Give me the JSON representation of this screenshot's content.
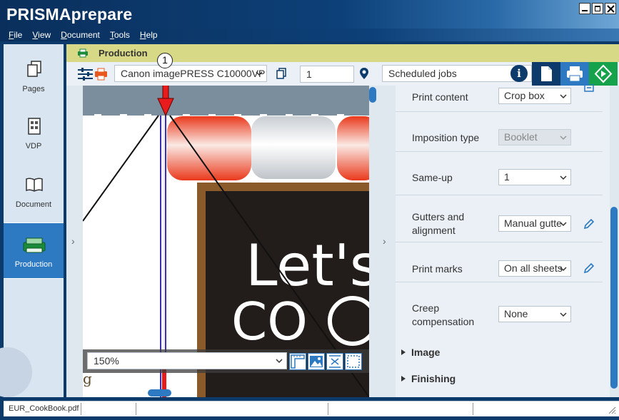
{
  "app": {
    "title": "PRISMAprepare",
    "menu": [
      "File",
      "View",
      "Document",
      "Tools",
      "Help"
    ]
  },
  "nav": {
    "items": [
      {
        "label": "Pages",
        "icon": "pages-icon"
      },
      {
        "label": "VDP",
        "icon": "vdp-icon"
      },
      {
        "label": "Document",
        "icon": "document-book-icon"
      },
      {
        "label": "Production",
        "icon": "production-icon",
        "active": true
      }
    ]
  },
  "production": {
    "title": "Production"
  },
  "toolbar": {
    "printer": "Canon imagePRESS C10000VP",
    "copies": "1",
    "destination": "Scheduled jobs"
  },
  "preview": {
    "zoom": "150%",
    "callout": "1",
    "poster_text_line1": "Let's",
    "poster_text_line2": "CO"
  },
  "panel": {
    "rows": [
      {
        "label": "Print content",
        "value": "Crop box"
      },
      {
        "label": "Imposition type",
        "value": "Booklet",
        "disabled": true
      },
      {
        "label": "Same-up",
        "value": "1"
      },
      {
        "label": "Gutters and alignment",
        "value": "Manual gutte",
        "editable": true
      },
      {
        "label": "Print marks",
        "value": "On all sheets",
        "editable": true
      },
      {
        "label": "Creep compensation",
        "value": "None"
      }
    ],
    "sections": [
      "Image",
      "Finishing"
    ]
  },
  "status": {
    "filename": "EUR_CookBook.pdf"
  },
  "colors": {
    "accent": "#2d79c2",
    "dark": "#0b3a6b",
    "go": "#16a24a",
    "production_bar": "#d7d986"
  }
}
